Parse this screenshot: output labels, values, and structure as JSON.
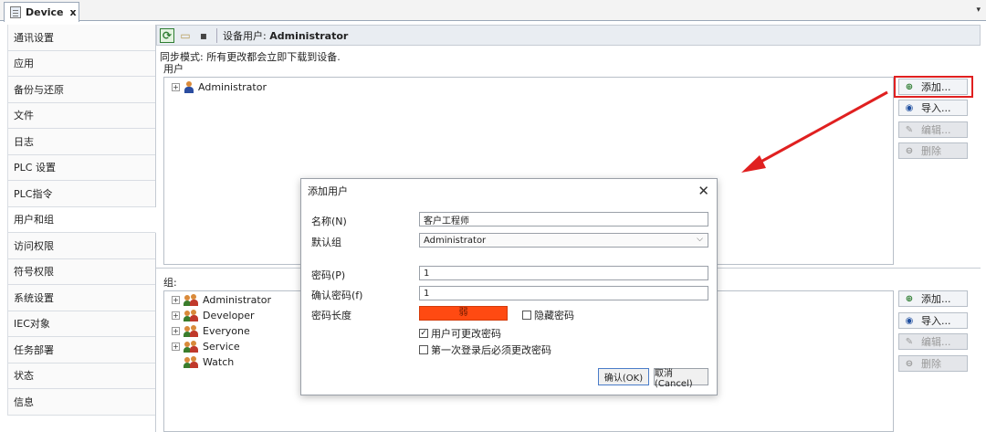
{
  "tab": {
    "title": "Device",
    "close": "x",
    "dropdown": "▾"
  },
  "nav": {
    "items": [
      {
        "label": "通讯设置"
      },
      {
        "label": "应用"
      },
      {
        "label": "备份与还原"
      },
      {
        "label": "文件"
      },
      {
        "label": "日志"
      },
      {
        "label": "PLC 设置"
      },
      {
        "label": "PLC指令"
      },
      {
        "label": "用户和组",
        "active": true
      },
      {
        "label": "访问权限"
      },
      {
        "label": "符号权限"
      },
      {
        "label": "系统设置"
      },
      {
        "label": "IEC对象"
      },
      {
        "label": "任务部署"
      },
      {
        "label": "状态"
      },
      {
        "label": "信息"
      }
    ]
  },
  "toolbar": {
    "device_user_label": "设备用户:",
    "device_user_value": "Administrator"
  },
  "main": {
    "sync_text": "同步模式: 所有更改都会立即下载到设备.",
    "users_label": "用户",
    "groups_label": "组:",
    "users": [
      {
        "name": "Administrator"
      }
    ],
    "groups": [
      {
        "name": "Administrator",
        "expandable": true
      },
      {
        "name": "Developer",
        "expandable": true
      },
      {
        "name": "Everyone",
        "expandable": true
      },
      {
        "name": "Service",
        "expandable": true
      },
      {
        "name": "Watch",
        "expandable": false
      }
    ],
    "user_buttons": {
      "add": "添加...",
      "import": "导入...",
      "edit": "编辑...",
      "delete": "删除"
    },
    "group_buttons": {
      "add": "添加...",
      "import": "导入...",
      "edit": "编辑...",
      "delete": "删除"
    }
  },
  "dialog": {
    "title": "添加用户",
    "close": "✕",
    "name_label": "名称(N)",
    "name_value": "客户工程师",
    "default_group_label": "默认组",
    "default_group_value": "Administrator",
    "password_label": "密码(P)",
    "password_value": "1",
    "confirm_label": "确认密码(f)",
    "confirm_value": "1",
    "strength_label": "密码长度",
    "strength_value": "弱",
    "hide_password_label": "隐藏密码",
    "hide_password_checked": false,
    "can_change_label": "用户可更改密码",
    "can_change_checked": true,
    "change_on_first_login_label": "第一次登录后必须更改密码",
    "change_on_first_login_checked": false,
    "ok_label": "确认(OK)",
    "cancel_label": "取消(Cancel)"
  },
  "colors": {
    "highlight": "#e02020",
    "strength_weak": "#ff4a12"
  }
}
